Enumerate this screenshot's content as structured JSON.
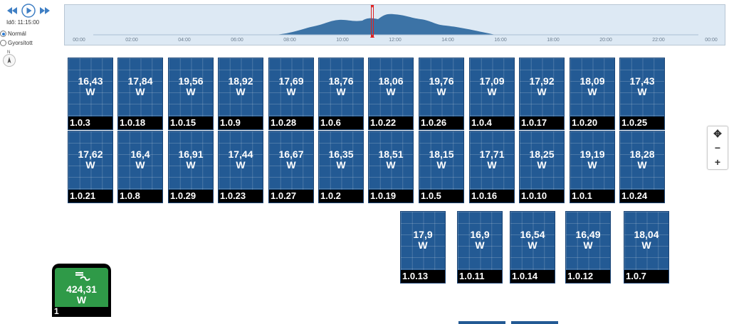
{
  "player": {
    "time_label": "Idő: 11:15:00",
    "modes": [
      {
        "label": "Normál",
        "selected": true
      },
      {
        "label": "Gyorsított",
        "selected": false
      }
    ]
  },
  "compass": {
    "label": "N"
  },
  "timeline": {
    "ticks": [
      "00:00",
      "02:00",
      "04:00",
      "06:00",
      "08:00",
      "10:00",
      "12:00",
      "14:00",
      "16:00",
      "18:00",
      "20:00",
      "22:00",
      "00:00"
    ]
  },
  "panels": {
    "row1": [
      {
        "power": "16,43",
        "unit": "W",
        "id": "1.0.3"
      },
      {
        "power": "17,84",
        "unit": "W",
        "id": "1.0.18"
      },
      {
        "power": "19,56",
        "unit": "W",
        "id": "1.0.15"
      },
      {
        "power": "18,92",
        "unit": "W",
        "id": "1.0.9"
      },
      {
        "power": "17,69",
        "unit": "W",
        "id": "1.0.28"
      },
      {
        "power": "18,76",
        "unit": "W",
        "id": "1.0.6"
      },
      {
        "power": "18,06",
        "unit": "W",
        "id": "1.0.22"
      },
      {
        "power": "19,76",
        "unit": "W",
        "id": "1.0.26"
      },
      {
        "power": "17,09",
        "unit": "W",
        "id": "1.0.4"
      },
      {
        "power": "17,92",
        "unit": "W",
        "id": "1.0.17"
      },
      {
        "power": "18,09",
        "unit": "W",
        "id": "1.0.20"
      },
      {
        "power": "17,43",
        "unit": "W",
        "id": "1.0.25"
      }
    ],
    "row2": [
      {
        "power": "17,62",
        "unit": "W",
        "id": "1.0.21"
      },
      {
        "power": "16,4",
        "unit": "W",
        "id": "1.0.8"
      },
      {
        "power": "16,91",
        "unit": "W",
        "id": "1.0.29"
      },
      {
        "power": "17,44",
        "unit": "W",
        "id": "1.0.23"
      },
      {
        "power": "16,67",
        "unit": "W",
        "id": "1.0.27"
      },
      {
        "power": "16,35",
        "unit": "W",
        "id": "1.0.2"
      },
      {
        "power": "18,51",
        "unit": "W",
        "id": "1.0.19"
      },
      {
        "power": "18,15",
        "unit": "W",
        "id": "1.0.5"
      },
      {
        "power": "17,71",
        "unit": "W",
        "id": "1.0.16"
      },
      {
        "power": "18,25",
        "unit": "W",
        "id": "1.0.10"
      },
      {
        "power": "19,19",
        "unit": "W",
        "id": "1.0.1"
      },
      {
        "power": "18,28",
        "unit": "W",
        "id": "1.0.24"
      }
    ],
    "row3": [
      {
        "power": "17,9",
        "unit": "W",
        "id": "1.0.13"
      },
      {
        "power": "16,9",
        "unit": "W",
        "id": "1.0.11"
      },
      {
        "power": "16,54",
        "unit": "W",
        "id": "1.0.14"
      },
      {
        "power": "16,49",
        "unit": "W",
        "id": "1.0.12"
      },
      {
        "power": "18,04",
        "unit": "W",
        "id": "1.0.7"
      }
    ]
  },
  "inverter": {
    "power": "424,31",
    "unit": "W",
    "id": "1"
  },
  "colors": {
    "panel": "#235a94",
    "inverter": "#2f9a48",
    "cursor": "#e02020",
    "timeline_fill": "#3c73a6"
  }
}
